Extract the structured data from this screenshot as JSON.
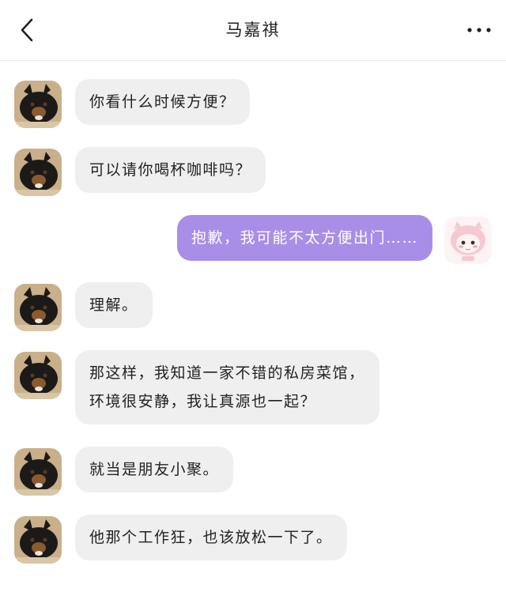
{
  "header": {
    "title": "马嘉祺",
    "back_icon": "chevron-left-icon",
    "more_icon": "more-horizontal-icon"
  },
  "colors": {
    "outgoing_bubble": "#a98ee8",
    "incoming_bubble": "#efefef"
  },
  "messages": [
    {
      "side": "left",
      "text": "你看什么时候方便？"
    },
    {
      "side": "left",
      "text": "可以请你喝杯咖啡吗？"
    },
    {
      "side": "right",
      "text": "抱歉，我可能不太方便出门……"
    },
    {
      "side": "left",
      "text": "理解。"
    },
    {
      "side": "left",
      "lines": [
        "那这样，我知道一家不错的私房菜馆，",
        "环境很安静，我让真源也一起？"
      ]
    },
    {
      "side": "left",
      "text": "就当是朋友小聚。"
    },
    {
      "side": "left",
      "text": "他那个工作狂，也该放松一下了。"
    }
  ]
}
